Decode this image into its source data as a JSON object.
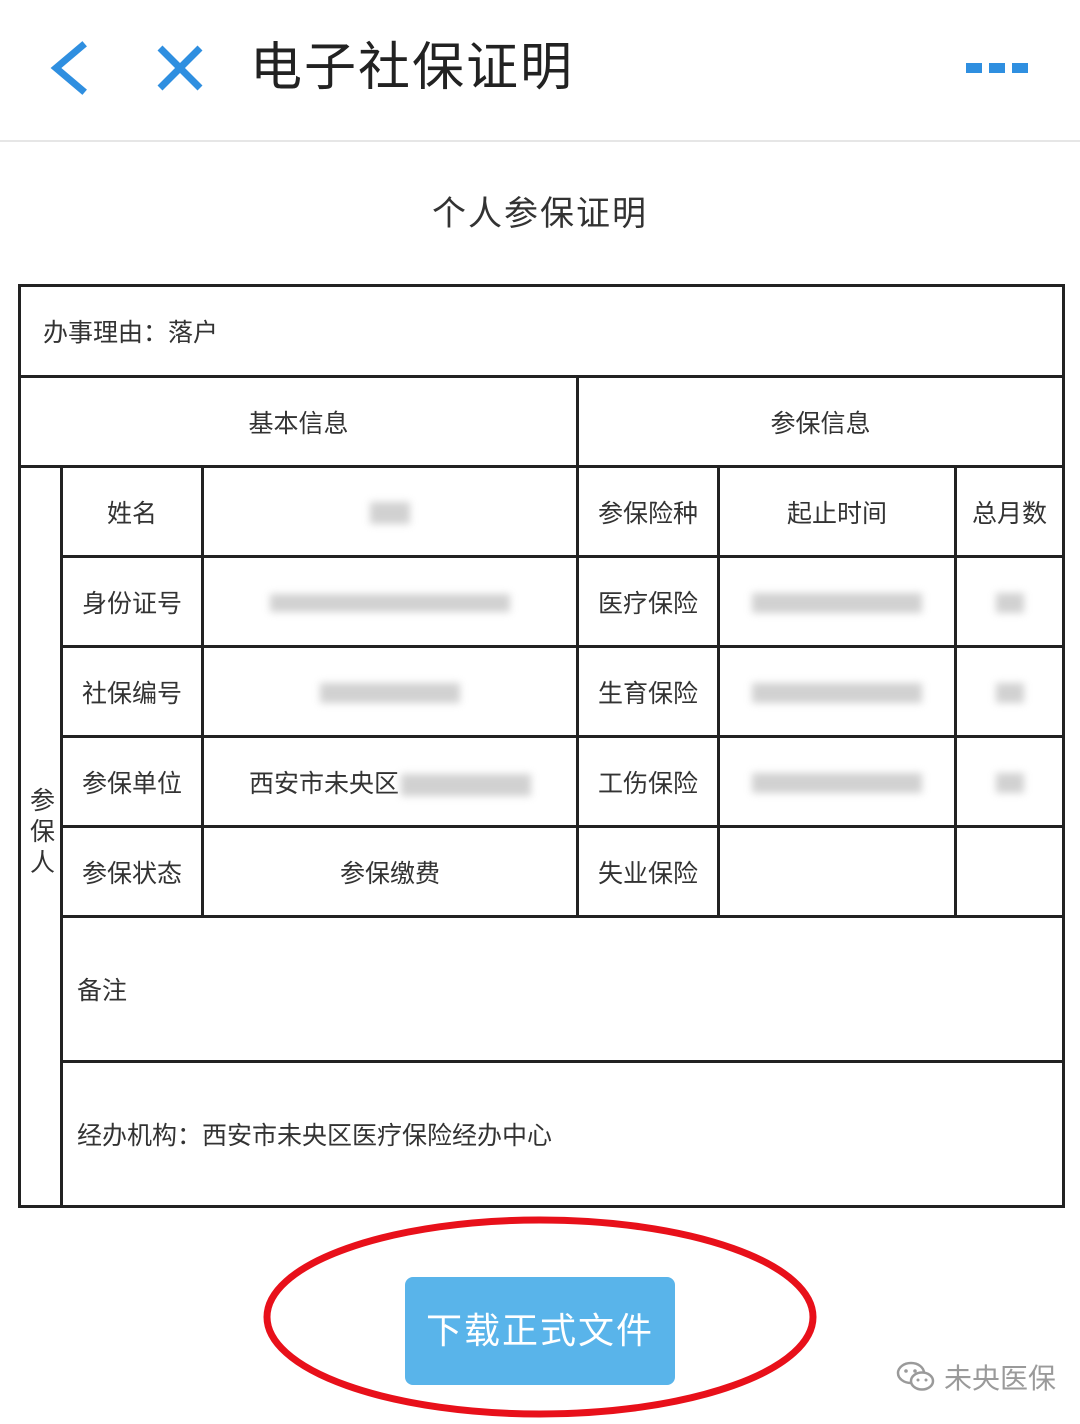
{
  "header": {
    "title": "电子社保证明",
    "back_icon": "chevron-left-icon",
    "close_icon": "close-icon",
    "more_icon": "more-dots-icon",
    "accent_color": "#2f8fe0"
  },
  "document": {
    "title": "个人参保证明",
    "reason": "办事理由：落户",
    "sections": {
      "basic_info": "基本信息",
      "insurance_info": "参保信息"
    },
    "side_label": "参保人",
    "basic_rows": [
      {
        "label": "姓名",
        "value": ""
      },
      {
        "label": "身份证号",
        "value": ""
      },
      {
        "label": "社保编号",
        "value": ""
      },
      {
        "label": "参保单位",
        "value": "西安市未央区"
      },
      {
        "label": "参保状态",
        "value": "参保缴费"
      }
    ],
    "insurance_header": {
      "type": "参保险种",
      "period": "起止时间",
      "months": "总月数"
    },
    "insurance_rows": [
      {
        "type": "医疗保险"
      },
      {
        "type": "生育保险"
      },
      {
        "type": "工伤保险"
      },
      {
        "type": "失业保险"
      }
    ],
    "remark_label": "备注",
    "agency": "经办机构：西安市未央区医疗保险经办中心"
  },
  "download_button": {
    "label": "下载正式文件",
    "color": "#59b4ea"
  },
  "annotation": {
    "ellipse_color": "#e8101a"
  },
  "watermark": {
    "icon": "wechat-icon",
    "text": "未央医保"
  }
}
